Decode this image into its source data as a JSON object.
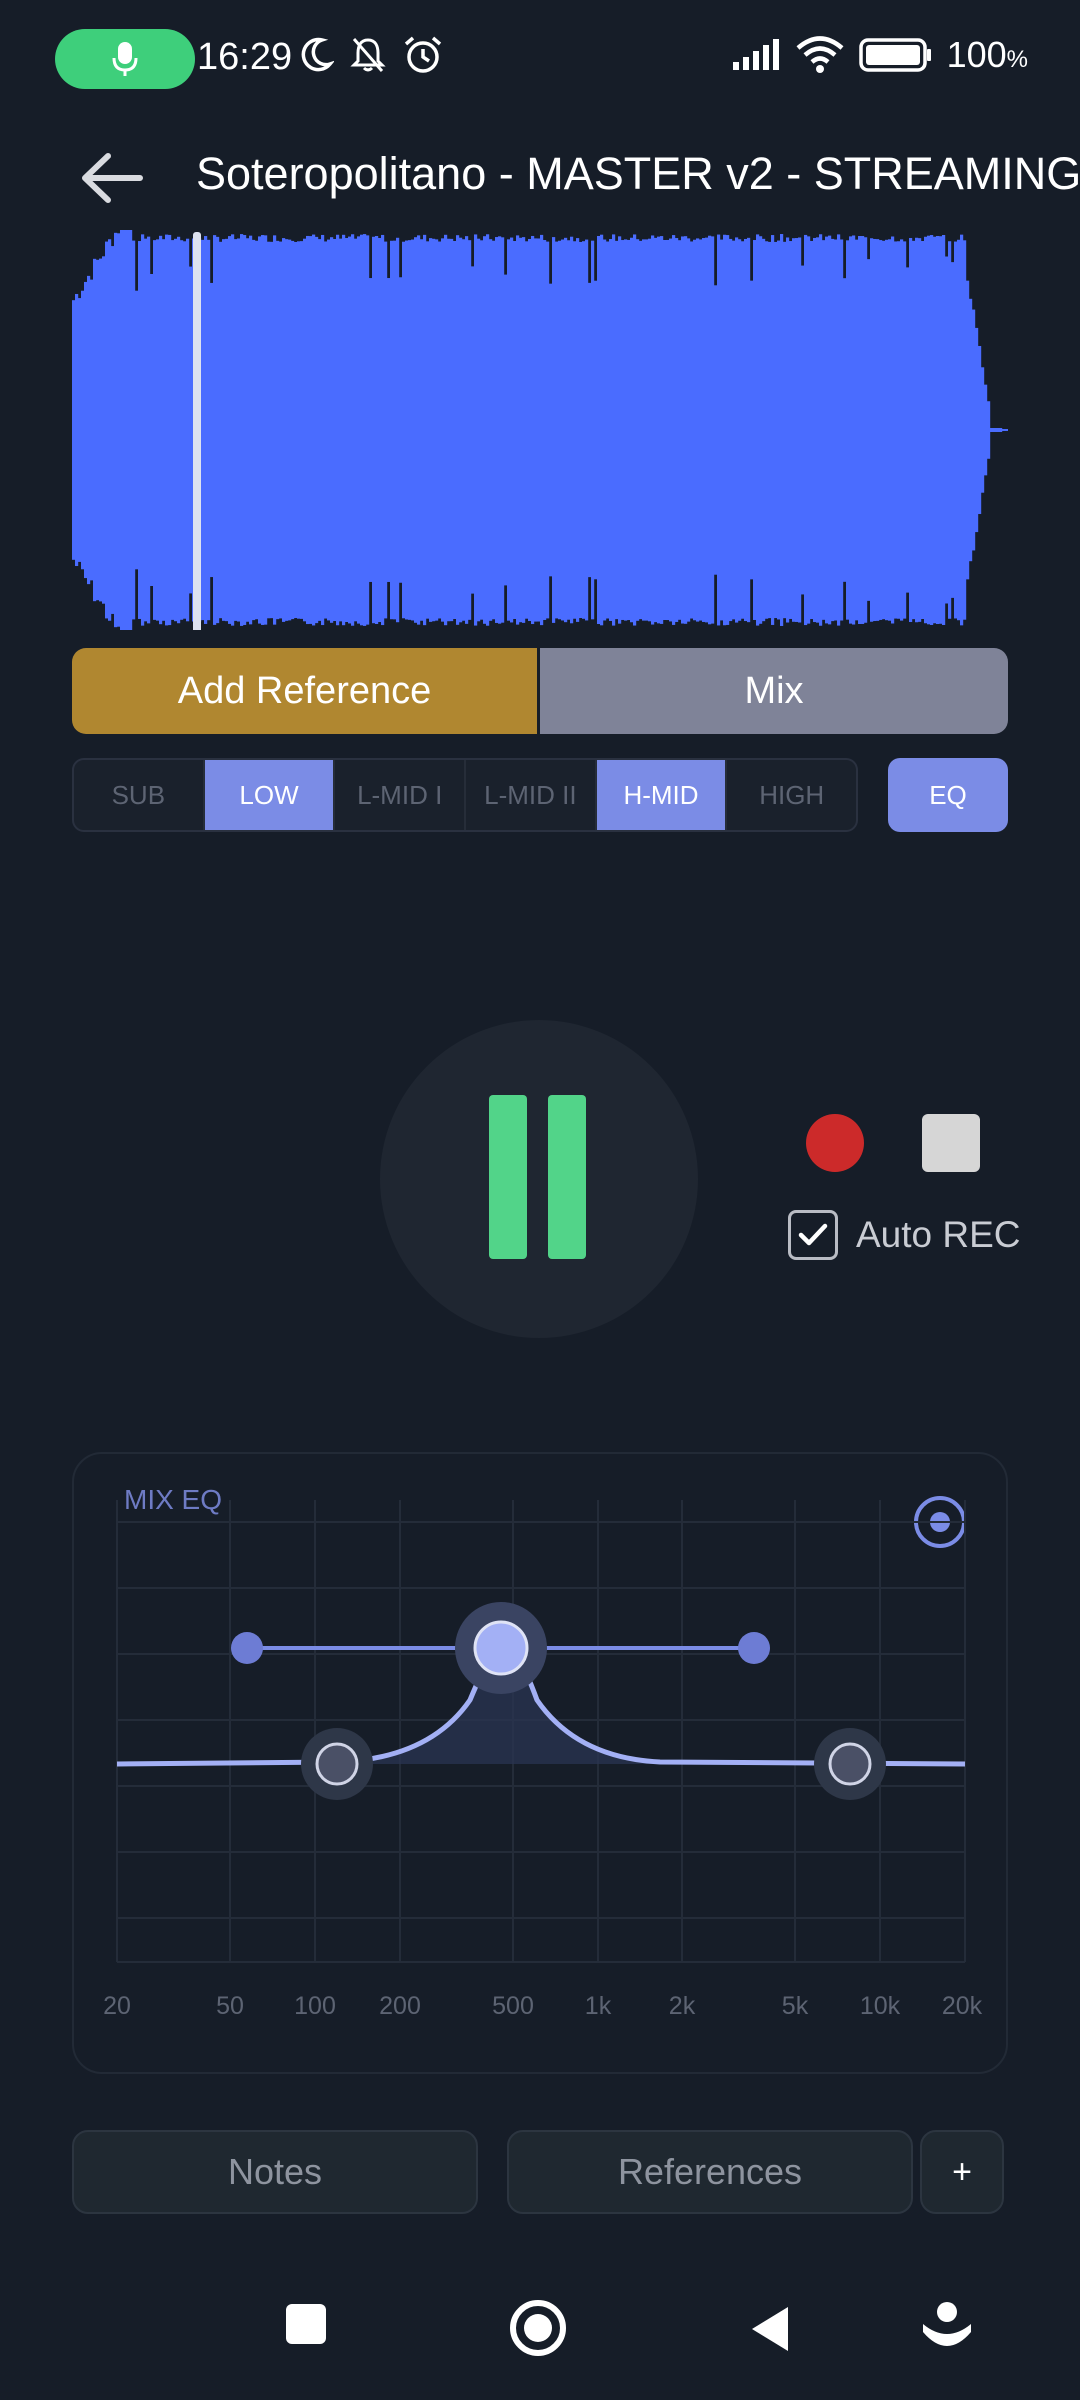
{
  "status_bar": {
    "time": "16:29",
    "battery": "100",
    "battery_unit": "%"
  },
  "header": {
    "title": "Soteropolitano - MASTER v2 - STREAMING"
  },
  "segment": {
    "add_reference": "Add Reference",
    "mix": "Mix"
  },
  "bands": [
    {
      "label": "SUB",
      "active": false
    },
    {
      "label": "LOW",
      "active": true
    },
    {
      "label": "L-MID I",
      "active": false
    },
    {
      "label": "L-MID II",
      "active": false
    },
    {
      "label": "H-MID",
      "active": true
    },
    {
      "label": "HIGH",
      "active": false
    }
  ],
  "eq_button": "EQ",
  "transport": {
    "auto_rec_label": "Auto REC",
    "auto_rec_checked": true
  },
  "eq_panel": {
    "title": "MIX EQ",
    "freq_labels": [
      "20",
      "50",
      "100",
      "200",
      "500",
      "1k",
      "2k",
      "5k",
      "10k",
      "20k"
    ]
  },
  "buttons": {
    "notes": "Notes",
    "references": "References",
    "add": "+"
  },
  "colors": {
    "accent": "#7b8ce6",
    "waveform": "#4a6cff",
    "reference": "#b08730",
    "mix": "#7f8398",
    "play": "#52d489",
    "record": "#cc2a2a"
  }
}
